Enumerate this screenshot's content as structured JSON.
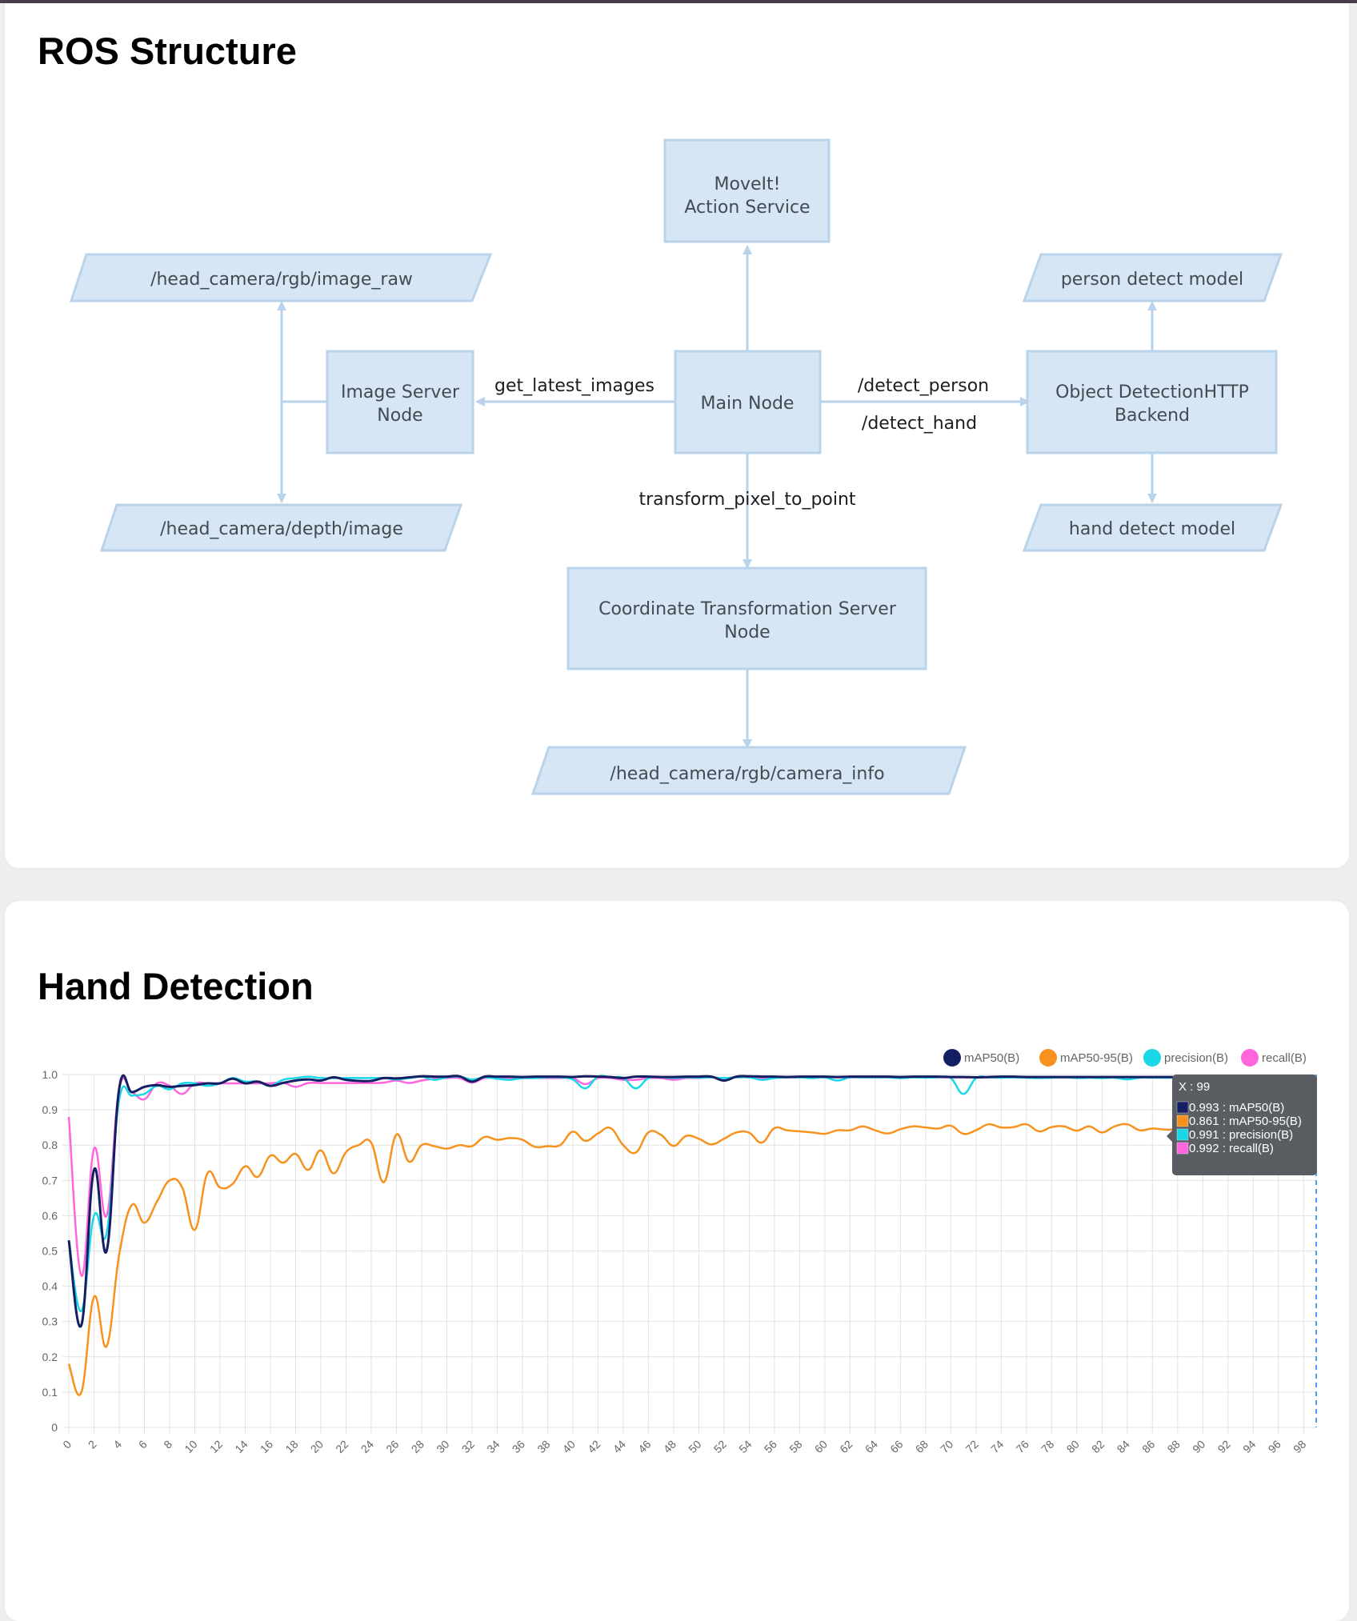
{
  "ros_section": {
    "title": "ROS Structure",
    "nodes": {
      "moveit": [
        "MoveIt!",
        "Action Service"
      ],
      "image_raw": [
        "/head_camera/rgb/image_raw"
      ],
      "person_model": [
        "person detect model"
      ],
      "image_server": [
        "Image Server",
        "Node"
      ],
      "main_node": [
        "Main Node"
      ],
      "object_detection": [
        "Object DetectionHTTP",
        "Backend"
      ],
      "depth_image": [
        "/head_camera/depth/image"
      ],
      "hand_model": [
        "hand detect model"
      ],
      "coord_server": [
        "Coordinate Transformation Server",
        "Node"
      ],
      "camera_info": [
        "/head_camera/rgb/camera_info"
      ]
    },
    "edge_labels": {
      "get_latest_images": "get_latest_images",
      "detect_person": "/detect_person",
      "detect_hand": "/detect_hand",
      "transform_pixel_to_point": "transform_pixel_to_point"
    },
    "colors": {
      "node_fill": "#d6e6f4",
      "node_stroke": "#b8d3ea",
      "edge": "#b8d3ea"
    }
  },
  "hand_section": {
    "title": "Hand Detection"
  },
  "chart_data": {
    "type": "line",
    "title": "",
    "xlabel": "",
    "ylabel": "",
    "ylim": [
      0,
      1.0
    ],
    "xlim": [
      0,
      99
    ],
    "grid": true,
    "legend_position": "top-right",
    "y_ticks": [
      "0",
      "0.1",
      "0.2",
      "0.3",
      "0.4",
      "0.5",
      "0.6",
      "0.7",
      "0.8",
      "0.9",
      "1.0"
    ],
    "x_tick_step": 2,
    "series": [
      {
        "name": "mAP50(B)",
        "color": "#141f63",
        "values": [
          0.53,
          0.29,
          0.73,
          0.5,
          0.96,
          0.95,
          0.965,
          0.97,
          0.965,
          0.968,
          0.97,
          0.975,
          0.975,
          0.988,
          0.975,
          0.98,
          0.968,
          0.976,
          0.983,
          0.986,
          0.983,
          0.992,
          0.985,
          0.982,
          0.982,
          0.99,
          0.989,
          0.992,
          0.995,
          0.994,
          0.994,
          0.995,
          0.98,
          0.994,
          0.994,
          0.994,
          0.993,
          0.994,
          0.994,
          0.994,
          0.993,
          0.995,
          0.994,
          0.993,
          0.99,
          0.994,
          0.994,
          0.993,
          0.993,
          0.994,
          0.994,
          0.994,
          0.983,
          0.994,
          0.995,
          0.994,
          0.994,
          0.993,
          0.994,
          0.994,
          0.994,
          0.993,
          0.994,
          0.994,
          0.994,
          0.994,
          0.993,
          0.994,
          0.994,
          0.994,
          0.993,
          0.993,
          0.992,
          0.993,
          0.994,
          0.994,
          0.993,
          0.993,
          0.993,
          0.993,
          0.993,
          0.993,
          0.993,
          0.993,
          0.993,
          0.993,
          0.993,
          0.993,
          0.993,
          0.993,
          0.993,
          0.993,
          0.993,
          0.993,
          0.993,
          0.993,
          0.993,
          0.993,
          0.993,
          0.993
        ]
      },
      {
        "name": "mAP50-95(B)",
        "color": "#f7921e",
        "values": [
          0.18,
          0.1,
          0.37,
          0.23,
          0.49,
          0.63,
          0.58,
          0.64,
          0.7,
          0.68,
          0.56,
          0.72,
          0.68,
          0.69,
          0.74,
          0.71,
          0.77,
          0.75,
          0.775,
          0.73,
          0.785,
          0.72,
          0.78,
          0.8,
          0.807,
          0.695,
          0.83,
          0.753,
          0.8,
          0.797,
          0.79,
          0.8,
          0.797,
          0.823,
          0.815,
          0.82,
          0.815,
          0.795,
          0.797,
          0.8,
          0.838,
          0.812,
          0.833,
          0.848,
          0.8,
          0.779,
          0.836,
          0.829,
          0.798,
          0.826,
          0.818,
          0.802,
          0.818,
          0.836,
          0.835,
          0.807,
          0.848,
          0.842,
          0.839,
          0.836,
          0.832,
          0.842,
          0.842,
          0.853,
          0.842,
          0.833,
          0.845,
          0.853,
          0.85,
          0.847,
          0.855,
          0.832,
          0.842,
          0.859,
          0.85,
          0.851,
          0.859,
          0.839,
          0.851,
          0.853,
          0.841,
          0.853,
          0.836,
          0.853,
          0.859,
          0.842,
          0.847,
          0.844,
          0.845,
          0.848,
          0.85,
          0.852,
          0.849,
          0.853,
          0.855,
          0.857,
          0.856,
          0.858,
          0.86,
          0.861
        ]
      },
      {
        "name": "precision(B)",
        "color": "#18d8e8",
        "values": [
          0.53,
          0.33,
          0.6,
          0.55,
          0.93,
          0.94,
          0.945,
          0.968,
          0.958,
          0.975,
          0.975,
          0.968,
          0.975,
          0.99,
          0.98,
          0.98,
          0.968,
          0.985,
          0.99,
          0.994,
          0.99,
          0.99,
          0.99,
          0.99,
          0.99,
          0.99,
          0.986,
          0.99,
          0.994,
          0.985,
          0.992,
          0.994,
          0.986,
          0.992,
          0.988,
          0.985,
          0.99,
          0.99,
          0.992,
          0.992,
          0.986,
          0.961,
          0.994,
          0.992,
          0.99,
          0.961,
          0.99,
          0.992,
          0.99,
          0.992,
          0.991,
          0.992,
          0.99,
          0.992,
          0.992,
          0.985,
          0.99,
          0.992,
          0.992,
          0.99,
          0.992,
          0.983,
          0.992,
          0.992,
          0.992,
          0.992,
          0.99,
          0.992,
          0.991,
          0.992,
          0.99,
          0.945,
          0.99,
          0.992,
          0.991,
          0.992,
          0.991,
          0.99,
          0.991,
          0.992,
          0.99,
          0.991,
          0.99,
          0.991,
          0.986,
          0.991,
          0.991,
          0.991,
          0.991,
          0.991,
          0.991,
          0.991,
          0.991,
          0.991,
          0.991,
          0.991,
          0.991,
          0.991,
          0.991,
          0.991
        ]
      },
      {
        "name": "recall(B)",
        "color": "#ff66dd",
        "values": [
          0.88,
          0.43,
          0.79,
          0.6,
          0.96,
          0.95,
          0.93,
          0.975,
          0.968,
          0.945,
          0.975,
          0.975,
          0.975,
          0.975,
          0.975,
          0.975,
          0.975,
          0.977,
          0.965,
          0.976,
          0.976,
          0.976,
          0.976,
          0.976,
          0.976,
          0.977,
          0.983,
          0.976,
          0.983,
          0.988,
          0.99,
          0.99,
          0.977,
          0.99,
          0.99,
          0.99,
          0.99,
          0.99,
          0.99,
          0.99,
          0.99,
          0.973,
          0.99,
          0.99,
          0.985,
          0.985,
          0.99,
          0.99,
          0.985,
          0.99,
          0.99,
          0.992,
          0.99,
          0.992,
          0.992,
          0.99,
          0.992,
          0.992,
          0.992,
          0.992,
          0.992,
          0.992,
          0.992,
          0.992,
          0.992,
          0.992,
          0.992,
          0.992,
          0.992,
          0.992,
          0.992,
          0.992,
          0.992,
          0.992,
          0.992,
          0.992,
          0.992,
          0.992,
          0.992,
          0.992,
          0.992,
          0.992,
          0.992,
          0.992,
          0.992,
          0.992,
          0.992,
          0.992,
          0.992,
          0.992,
          0.992,
          0.992,
          0.992,
          0.992,
          0.992,
          0.992,
          0.992,
          0.992,
          0.992,
          0.992
        ]
      }
    ],
    "tooltip": {
      "title": "X : 99",
      "items": [
        {
          "label": "0.993 : mAP50(B)",
          "color": "#141f63"
        },
        {
          "label": "0.861 : mAP50-95(B)",
          "color": "#f7921e"
        },
        {
          "label": "0.991 : precision(B)",
          "color": "#18d8e8"
        },
        {
          "label": "0.992 : recall(B)",
          "color": "#ff66dd"
        }
      ],
      "hover_x": 99
    }
  }
}
